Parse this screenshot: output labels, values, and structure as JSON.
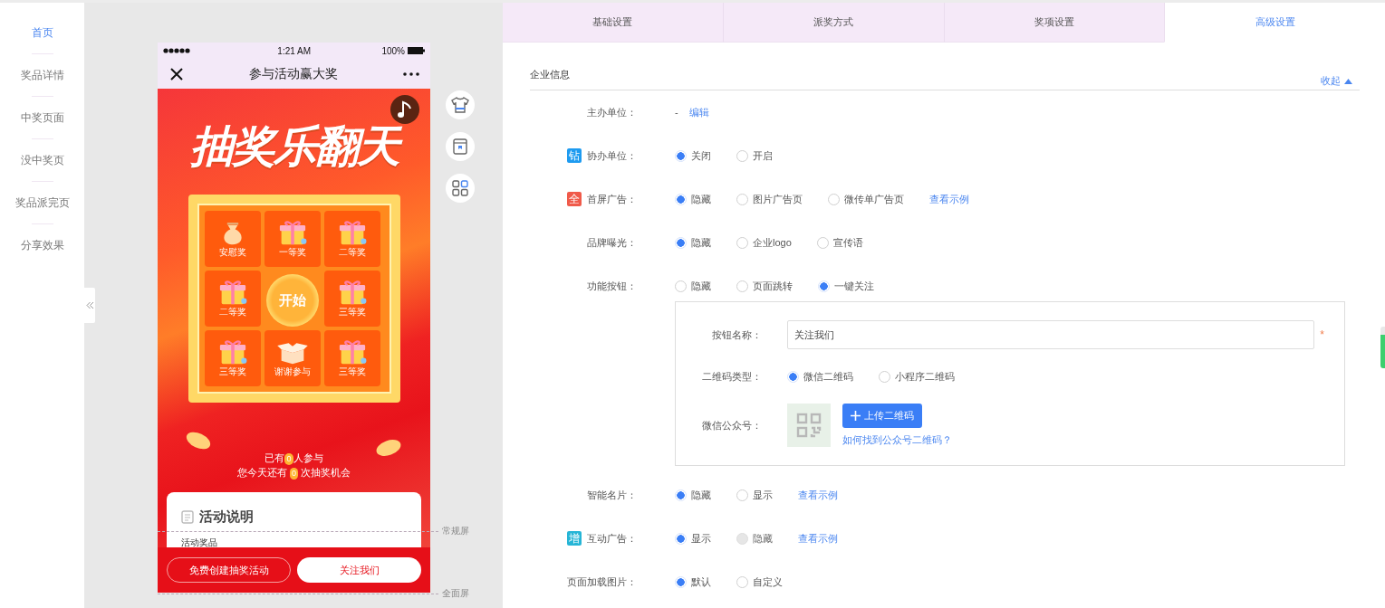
{
  "sidebar": {
    "items": [
      {
        "label": "首页",
        "selected": true
      },
      {
        "label": "奖品详情",
        "selected": false
      },
      {
        "label": "中奖页面",
        "selected": false
      },
      {
        "label": "没中奖页",
        "selected": false
      },
      {
        "label": "奖品派完页",
        "selected": false
      },
      {
        "label": "分享效果",
        "selected": false
      }
    ]
  },
  "phone": {
    "status_bar": {
      "time": "1:21 AM",
      "battery": "100%"
    },
    "nav_title": "参与活动赢大奖",
    "poster": {
      "title": "抽奖乐翻天",
      "prizes": [
        {
          "label": "安慰奖",
          "kind": "pouch"
        },
        {
          "label": "一等奖",
          "kind": "gift"
        },
        {
          "label": "二等奖",
          "kind": "gift"
        },
        {
          "label": "二等奖",
          "kind": "gift"
        },
        {
          "label": "三等奖",
          "kind": "gift"
        },
        {
          "label": "三等奖",
          "kind": "gift"
        },
        {
          "label": "谢谢参与",
          "kind": "box"
        },
        {
          "label": "三等奖",
          "kind": "gift"
        }
      ],
      "start_button": "开始",
      "participants": {
        "prefix": "已有",
        "count": "0",
        "suffix": "人参与"
      },
      "chances": {
        "prefix": "您今天还有",
        "count": "0",
        "suffix": "次抽奖机会"
      }
    },
    "card": {
      "title": "活动说明",
      "first_line": "活动奖品"
    },
    "buttons": [
      {
        "label": "免费创建抽奖活动",
        "kind": "outline"
      },
      {
        "label": "关注我们",
        "kind": "filled"
      }
    ]
  },
  "screen_marks": [
    {
      "label": "常规屏"
    },
    {
      "label": "全面屏"
    }
  ],
  "tabs": [
    {
      "label": "基础设置",
      "selected": false
    },
    {
      "label": "派奖方式",
      "selected": false
    },
    {
      "label": "奖项设置",
      "selected": false
    },
    {
      "label": "高级设置",
      "selected": true
    }
  ],
  "section": {
    "title": "企业信息",
    "toggle": "收起"
  },
  "rows": [
    {
      "label": "主办单位：",
      "kind": "text",
      "value": "-",
      "link": "编辑"
    },
    {
      "label": "协办单位：",
      "badge": {
        "text": "钻",
        "color": "#1e9bf0"
      },
      "kind": "radio",
      "options": [
        {
          "label": "关闭",
          "selected": true,
          "disabled": false
        },
        {
          "label": "开启",
          "selected": false,
          "disabled": false
        }
      ]
    },
    {
      "label": "首屏广告：",
      "badge": {
        "text": "全",
        "color": "#f05a4a"
      },
      "kind": "radio",
      "link": "查看示例",
      "options": [
        {
          "label": "隐藏",
          "selected": true,
          "disabled": false
        },
        {
          "label": "图片广告页",
          "selected": false,
          "disabled": false
        },
        {
          "label": "微传单广告页",
          "selected": false,
          "disabled": false
        }
      ]
    },
    {
      "label": "品牌曝光：",
      "kind": "radio",
      "options": [
        {
          "label": "隐藏",
          "selected": true,
          "disabled": false
        },
        {
          "label": "企业logo",
          "selected": false,
          "disabled": false
        },
        {
          "label": "宣传语",
          "selected": false,
          "disabled": false
        }
      ]
    },
    {
      "label": "功能按钮：",
      "kind": "radio",
      "options": [
        {
          "label": "隐藏",
          "selected": false,
          "disabled": false
        },
        {
          "label": "页面跳转",
          "selected": false,
          "disabled": false
        },
        {
          "label": "一键关注",
          "selected": true,
          "disabled": false
        }
      ],
      "panel": [
        {
          "kind": "input",
          "label": "按钮名称：",
          "value": "关注我们",
          "required_mark": "*"
        },
        {
          "kind": "radio",
          "label": "二维码类型：",
          "options": [
            {
              "label": "微信二维码",
              "selected": true,
              "disabled": false
            },
            {
              "label": "小程序二维码",
              "selected": false,
              "disabled": false
            }
          ]
        },
        {
          "kind": "upload",
          "label": "微信公众号：",
          "button": "上传二维码",
          "help": "如何找到公众号二维码？"
        }
      ]
    },
    {
      "label": "智能名片：",
      "kind": "radio",
      "link": "查看示例",
      "options": [
        {
          "label": "隐藏",
          "selected": true,
          "disabled": false
        },
        {
          "label": "显示",
          "selected": false,
          "disabled": false
        }
      ]
    },
    {
      "label": "互动广告：",
      "badge": {
        "text": "增",
        "color": "#26b5d6"
      },
      "kind": "radio",
      "link": "查看示例",
      "options": [
        {
          "label": "显示",
          "selected": true,
          "disabled": false
        },
        {
          "label": "隐藏",
          "selected": false,
          "disabled": true
        }
      ]
    },
    {
      "label": "页面加载图片：",
      "kind": "radio",
      "options": [
        {
          "label": "默认",
          "selected": true,
          "disabled": false
        },
        {
          "label": "自定义",
          "selected": false,
          "disabled": false
        }
      ]
    }
  ]
}
